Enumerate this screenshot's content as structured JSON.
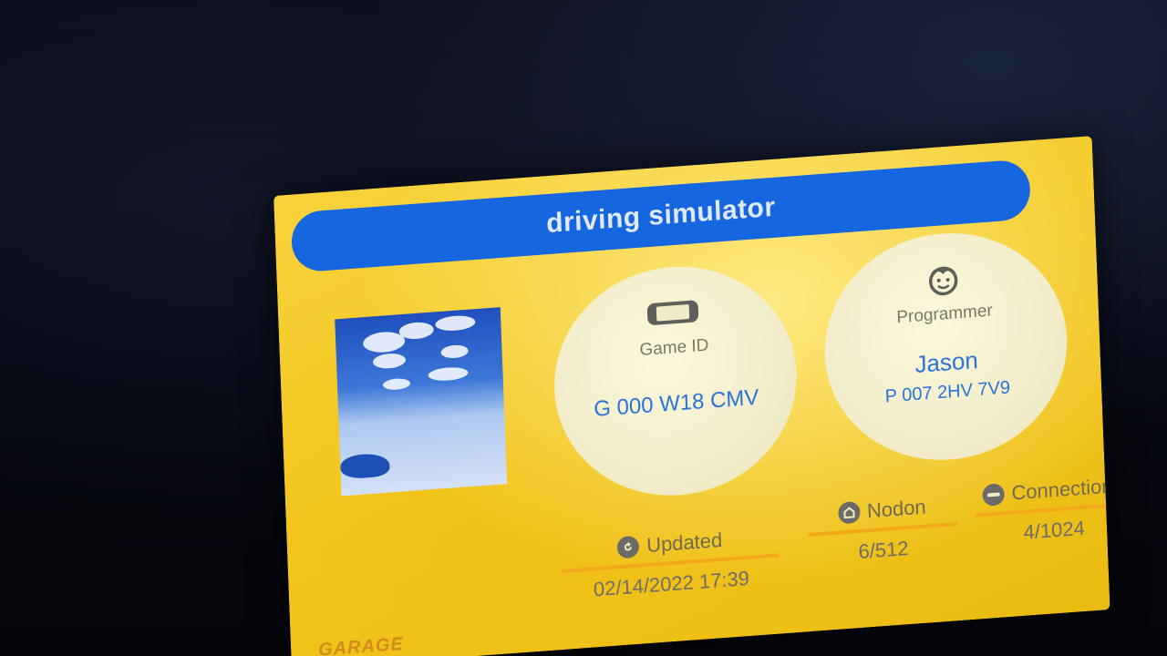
{
  "game": {
    "title": "driving simulator"
  },
  "game_id": {
    "label": "Game ID",
    "value": "G 000 W18 CMV",
    "icon": "console-icon"
  },
  "programmer": {
    "label": "Programmer",
    "name": "Jason",
    "id": "P 007 2HV 7V9",
    "icon": "smiley-face-icon"
  },
  "stats": {
    "updated_label": "Updated",
    "updated_value": "02/14/2022 17:39",
    "nodon_label": "Nodon",
    "nodon_value": "6/512",
    "connections_label": "Connections",
    "connections_value": "4/1024"
  },
  "branding": {
    "logo_text": "GARAGE"
  },
  "colors": {
    "accent_blue": "#1666e0",
    "panel_yellow": "#f2c71f",
    "underline_orange": "#f2a81b",
    "value_blue": "#2a73db"
  }
}
